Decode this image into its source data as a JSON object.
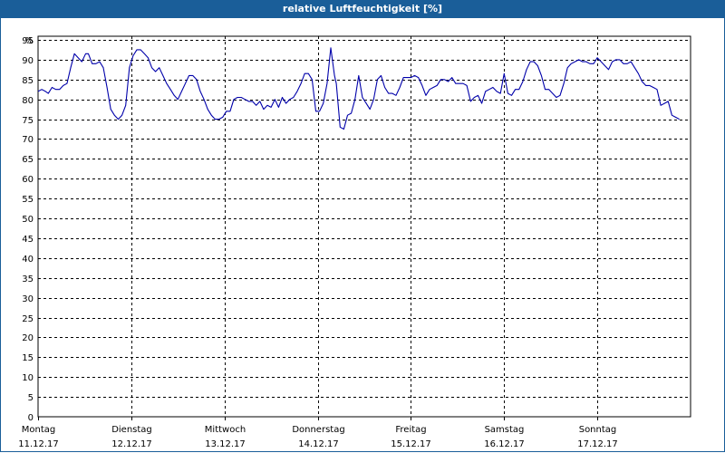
{
  "window": {
    "title": "relative Luftfeuchtigkeit [%]"
  },
  "chart_data": {
    "type": "line",
    "title": "relative Luftfeuchtigkeit [%]",
    "ylabel": "%",
    "xlabel": "",
    "ylim": [
      0,
      95
    ],
    "yticks": [
      0,
      5,
      10,
      15,
      20,
      25,
      30,
      35,
      40,
      45,
      50,
      55,
      60,
      65,
      70,
      75,
      80,
      85,
      90,
      95
    ],
    "grid": true,
    "legend": "none",
    "line_color": "#0000aa",
    "days": [
      {
        "weekday": "Montag",
        "date": "11.12.17"
      },
      {
        "weekday": "Dienstag",
        "date": "12.12.17"
      },
      {
        "weekday": "Mittwoch",
        "date": "13.12.17"
      },
      {
        "weekday": "Donnerstag",
        "date": "14.12.17"
      },
      {
        "weekday": "Freitag",
        "date": "15.12.17"
      },
      {
        "weekday": "Samstag",
        "date": "16.12.17"
      },
      {
        "weekday": "Sonntag",
        "date": "17.12.17"
      }
    ],
    "series": [
      {
        "x_days": [
          0.0,
          0.04,
          0.08,
          0.11,
          0.15,
          0.19,
          0.23,
          0.27,
          0.31,
          0.35,
          0.39,
          0.43,
          0.47,
          0.51,
          0.54,
          0.58,
          0.62,
          0.66,
          0.7,
          0.74,
          0.78,
          0.82,
          0.86,
          0.9,
          0.94,
          0.98,
          1.02,
          1.06,
          1.1,
          1.14,
          1.18,
          1.22,
          1.26,
          1.3,
          1.34,
          1.38,
          1.42,
          1.46,
          1.5,
          1.54,
          1.58,
          1.62,
          1.66,
          1.7,
          1.74,
          1.78,
          1.82,
          1.86,
          1.9,
          1.94,
          1.98,
          2.02,
          2.06,
          2.1,
          2.14,
          2.18,
          2.22,
          2.26,
          2.3,
          2.34,
          2.38,
          2.42,
          2.46,
          2.5,
          2.54,
          2.58,
          2.62,
          2.66,
          2.7,
          2.74,
          2.78,
          2.82,
          2.86,
          2.9,
          2.94,
          2.98,
          3.02,
          3.06,
          3.1,
          3.14,
          3.18,
          3.2,
          3.24,
          3.28,
          3.32,
          3.36,
          3.4,
          3.44,
          3.48,
          3.52,
          3.56,
          3.6,
          3.64,
          3.68,
          3.72,
          3.76,
          3.8,
          3.84,
          3.88,
          3.92,
          3.96,
          4.0,
          4.04,
          4.08,
          4.12,
          4.16,
          4.2,
          4.24,
          4.28,
          4.32,
          4.36,
          4.4,
          4.44,
          4.48,
          4.52,
          4.56,
          4.6,
          4.64,
          4.68,
          4.72,
          4.76,
          4.8,
          4.84,
          4.88,
          4.92,
          4.96,
          5.0,
          5.04,
          5.08,
          5.12,
          5.16,
          5.2,
          5.24,
          5.28,
          5.32,
          5.36,
          5.4,
          5.44,
          5.48,
          5.52,
          5.56,
          5.6,
          5.64,
          5.68,
          5.72,
          5.76,
          5.8,
          5.84,
          5.88,
          5.92,
          5.96,
          6.0,
          6.04,
          6.08,
          6.12,
          6.16,
          6.2,
          6.24,
          6.28,
          6.32,
          6.36,
          6.4,
          6.44,
          6.48,
          6.52,
          6.56,
          6.6,
          6.64,
          6.68,
          6.72,
          6.76,
          6.8,
          6.84,
          6.88,
          6.92,
          6.96,
          7.0
        ],
        "values": [
          82,
          82.5,
          82,
          81.5,
          83,
          82.5,
          82.5,
          83.5,
          84,
          88,
          91.5,
          90.5,
          89.5,
          91.5,
          91.5,
          89,
          89,
          89.5,
          88,
          83,
          77.5,
          76,
          75,
          76,
          78.5,
          88,
          91,
          92.5,
          92.5,
          91.5,
          90.5,
          88,
          87,
          88,
          86,
          84,
          82.5,
          81,
          80,
          82,
          84,
          86,
          86,
          85,
          82,
          80,
          77.5,
          76,
          75,
          75,
          75.5,
          77,
          77,
          80,
          80.5,
          80.5,
          80,
          79.5,
          79.5,
          78.5,
          79.5,
          77.5,
          78.5,
          78,
          80,
          78,
          80.5,
          79,
          80,
          80.5,
          82,
          84,
          86.5,
          86.5,
          85,
          77,
          77,
          79,
          84,
          93,
          86,
          84,
          73,
          72.5,
          76,
          76.5,
          80,
          86,
          80.5,
          79,
          77.5,
          80,
          85,
          86,
          83,
          81.5,
          81.5,
          81,
          83,
          85.5,
          85.5,
          85.5,
          86,
          85.5,
          83.5,
          81,
          82.5,
          83,
          83.5,
          85,
          85,
          84.5,
          85.5,
          84,
          84,
          84,
          83.5,
          79.5,
          80.5,
          81,
          79,
          82,
          82.5,
          83,
          82,
          81.5,
          86.5,
          81.5,
          81,
          82.5,
          82.5,
          84.5,
          87.5,
          89.5,
          89.5,
          88.5,
          86,
          82.5,
          82.5,
          81.5,
          80.5,
          81,
          84,
          88,
          89,
          89.5,
          90,
          89.5,
          89.5,
          89,
          89,
          90.5,
          89.5,
          88.5,
          87.5,
          89.5,
          90,
          90,
          89,
          89,
          89.5,
          88,
          86.5,
          84.5,
          83.5,
          83.5,
          83,
          82.5,
          78.5,
          79,
          79.5,
          76,
          75.5,
          75
        ]
      }
    ]
  }
}
